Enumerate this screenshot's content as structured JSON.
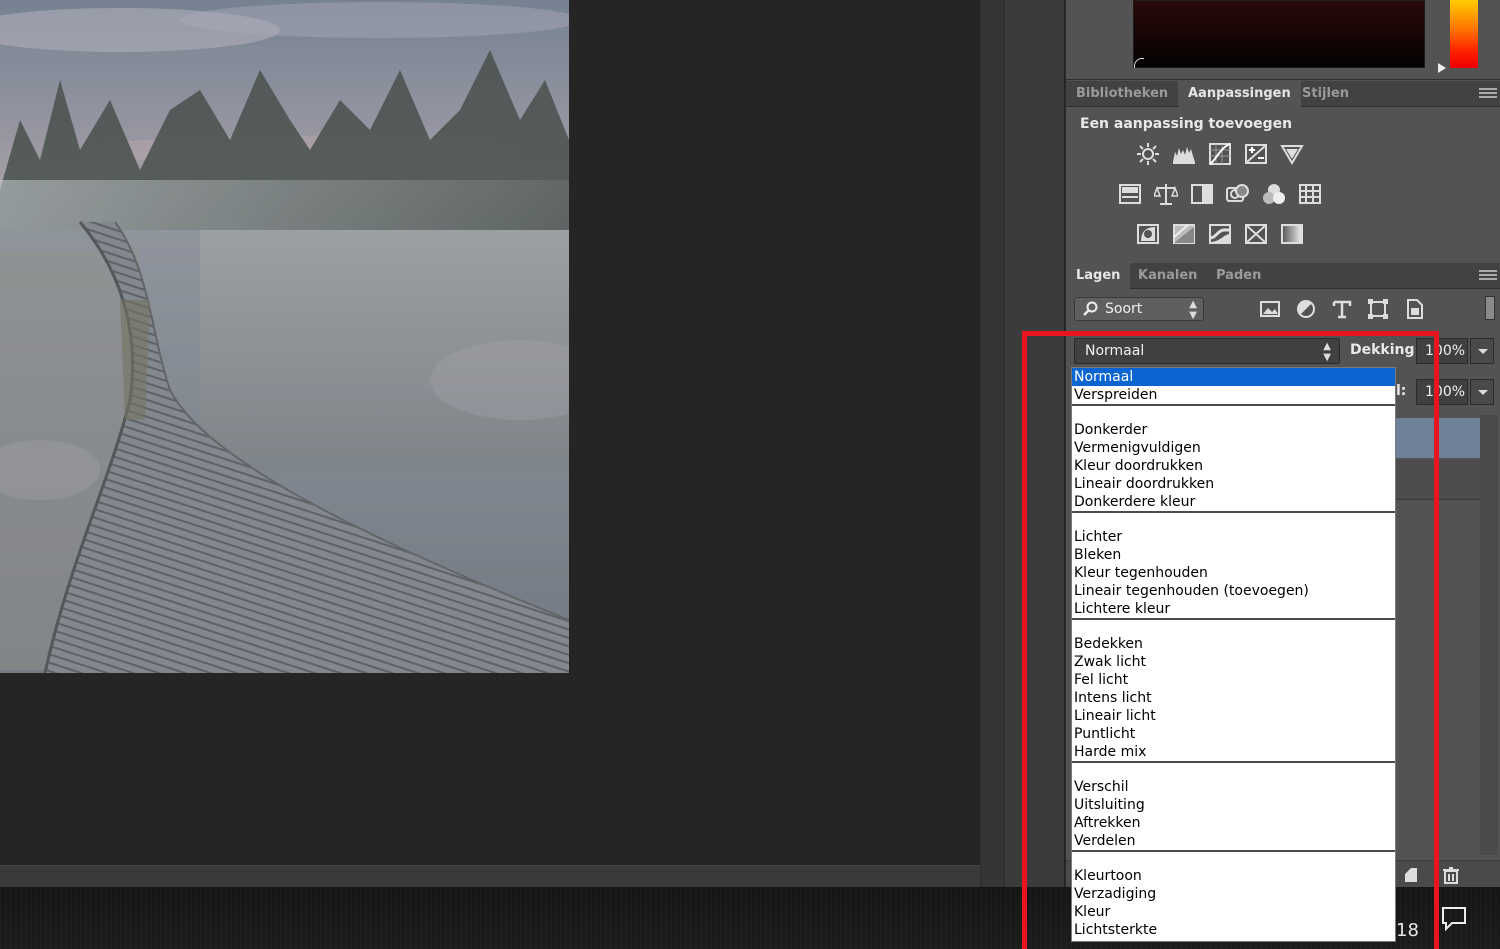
{
  "panels": {
    "top_tabs": [
      {
        "label": "Bibliotheken",
        "active": false
      },
      {
        "label": "Aanpassingen",
        "active": true
      },
      {
        "label": "Stijlen",
        "active": false
      }
    ],
    "adjustments": {
      "heading": "Een aanpassing toevoegen",
      "icons": [
        "brightness-contrast-icon",
        "levels-icon",
        "curves-icon",
        "exposure-icon",
        "vibrance-icon",
        "hue-saturation-icon",
        "color-balance-icon",
        "black-white-icon",
        "photo-filter-icon",
        "channel-mixer-icon",
        "color-lookup-icon",
        "invert-icon",
        "posterize-icon",
        "threshold-icon",
        "selective-color-icon",
        "gradient-map-icon"
      ]
    },
    "layer_tabs": [
      {
        "label": "Lagen",
        "active": true
      },
      {
        "label": "Kanalen",
        "active": false
      },
      {
        "label": "Paden",
        "active": false
      }
    ],
    "filter": {
      "kind_label": "Soort",
      "icons": [
        "image-filter-icon",
        "adjustment-filter-icon",
        "type-filter-icon",
        "shape-filter-icon",
        "smart-object-filter-icon"
      ]
    },
    "blend_mode": "Normaal",
    "opacity_label": "Dekking:",
    "opacity_value": "100%",
    "fill_label": "l:",
    "fill_value": "100%"
  },
  "taskbar": {
    "clock_fragment": "18"
  },
  "dropdown": {
    "groups": [
      [
        "Normaal",
        "Verspreiden"
      ],
      [
        "Donkerder",
        "Vermenigvuldigen",
        "Kleur doordrukken",
        "Lineair doordrukken",
        "Donkerdere kleur"
      ],
      [
        "Lichter",
        "Bleken",
        "Kleur tegenhouden",
        "Lineair tegenhouden (toevoegen)",
        "Lichtere kleur"
      ],
      [
        "Bedekken",
        "Zwak licht",
        "Fel licht",
        "Intens licht",
        "Lineair licht",
        "Puntlicht",
        "Harde mix"
      ],
      [
        "Verschil",
        "Uitsluiting",
        "Aftrekken",
        "Verdelen"
      ],
      [
        "Kleurtoon",
        "Verzadiging",
        "Kleur",
        "Lichtsterkte"
      ]
    ],
    "selected": "Normaal"
  },
  "colors": {
    "highlight": "#e8141e",
    "selection": "#0a64d2",
    "panel_bg": "#535353",
    "canvas_bg": "#252525"
  }
}
